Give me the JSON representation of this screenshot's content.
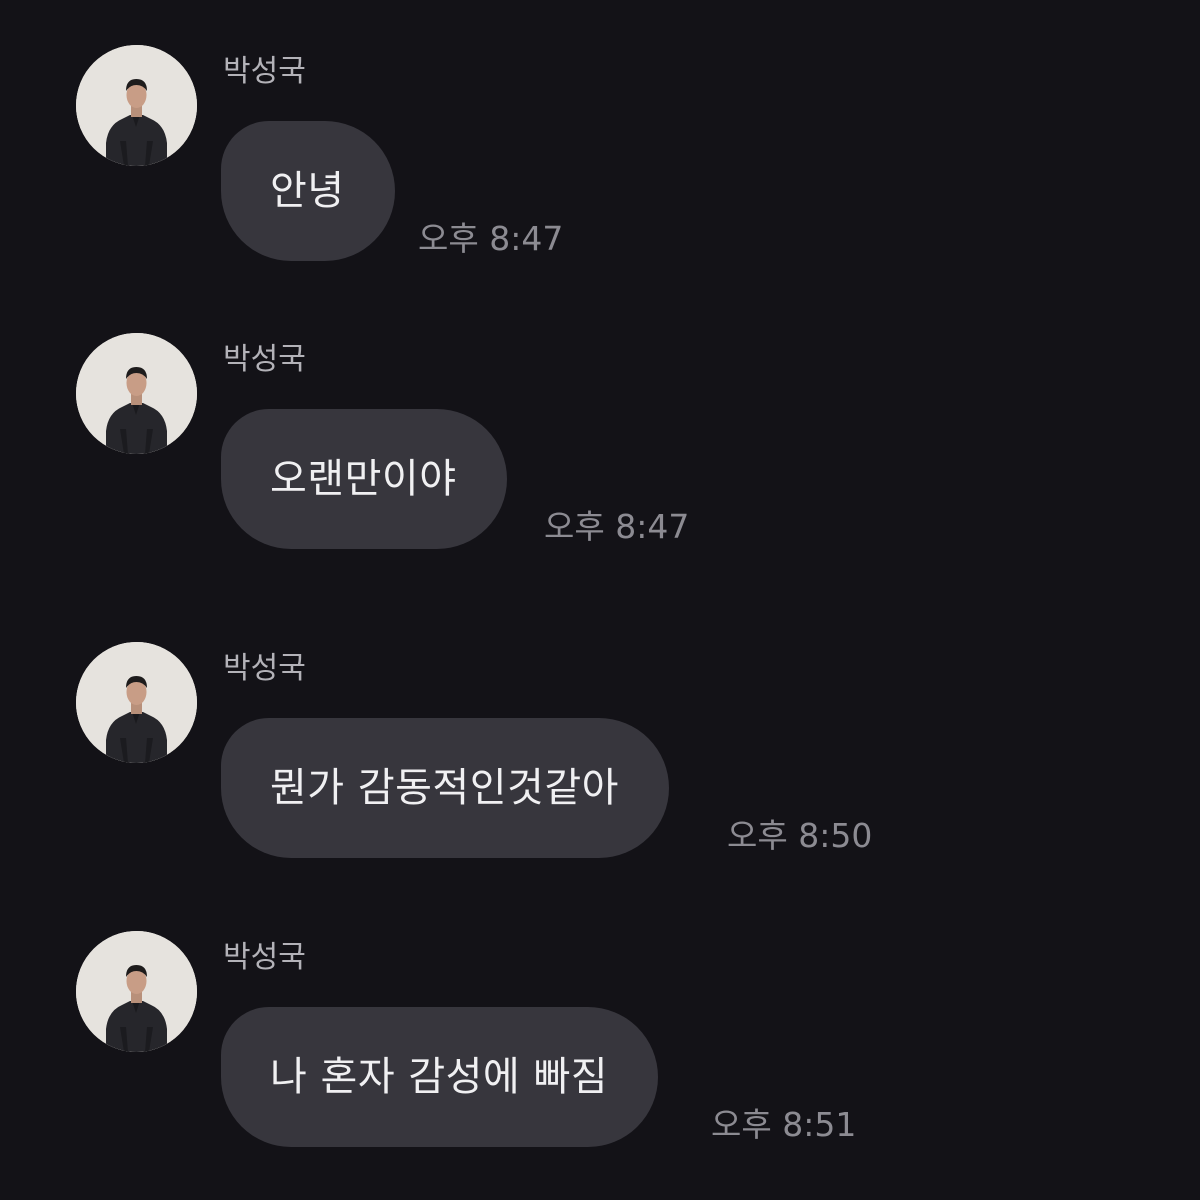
{
  "messages": [
    {
      "sender": "박성국",
      "text": "안녕",
      "time": "오후 8:47",
      "avatar_icon": "profile-photo"
    },
    {
      "sender": "박성국",
      "text": "오랜만이야",
      "time": "오후 8:47",
      "avatar_icon": "profile-photo"
    },
    {
      "sender": "박성국",
      "text": "뭔가 감동적인것같아",
      "time": "오후 8:50",
      "avatar_icon": "profile-photo"
    },
    {
      "sender": "박성국",
      "text": "나 혼자 감성에 빠짐",
      "time": "오후 8:51",
      "avatar_icon": "profile-photo"
    }
  ],
  "colors": {
    "background": "#131217",
    "bubble": "#37363d",
    "bubble_text": "#f0f0f2",
    "sender_text": "#b3b2b8",
    "time_text": "#8c8b92",
    "avatar_background": "#e9e6e1"
  }
}
